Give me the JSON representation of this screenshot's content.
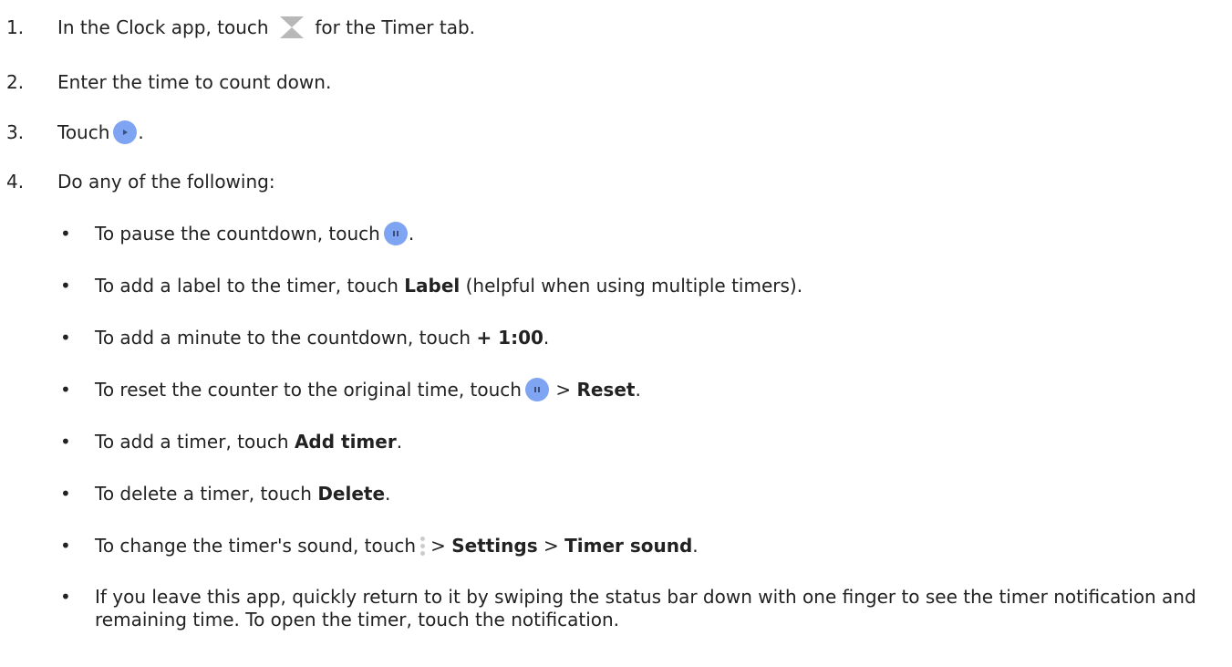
{
  "steps": [
    {
      "num": "1.",
      "pre": "In the Clock app, touch",
      "post": "for the Timer tab."
    },
    {
      "num": "2.",
      "text": "Enter the time to count down."
    },
    {
      "num": "3.",
      "pre": "Touch",
      "post": "."
    },
    {
      "num": "4.",
      "text": "Do any of the following:"
    }
  ],
  "bullet_char": "•",
  "bullets": [
    {
      "pre": "To pause the countdown, touch",
      "post": "."
    },
    {
      "pre": "To add a label to the timer, touch",
      "bold": "Label",
      "post": "(helpful when using multiple timers)."
    },
    {
      "pre": "To add a minute to the countdown, touch",
      "bold": "+ 1:00",
      "post": "."
    },
    {
      "pre": "To reset the counter to the original time, touch",
      "sep": ">",
      "bold": "Reset",
      "post": "."
    },
    {
      "pre": "To add a timer, touch",
      "bold": "Add timer",
      "post": "."
    },
    {
      "pre": "To delete a timer, touch",
      "bold": "Delete",
      "post": "."
    },
    {
      "pre": "To change the timer's sound, touch",
      "sep1": ">",
      "bold1": "Settings",
      "sep2": ">",
      "bold2": "Timer sound",
      "post": "."
    },
    {
      "text": "If you leave this app, quickly return to it by swiping the status bar down with one finger to see the timer notification and remaining time. To open the timer, touch the notification."
    }
  ],
  "icons": {
    "timer_tab": "hourglass-icon",
    "start": "play-icon",
    "pause": "pause-icon",
    "menu": "more-vert-icon"
  },
  "colors": {
    "button_fill": "#7ea4f2",
    "hourglass": "#b8b8b8",
    "menu_dots": "#cccccc"
  }
}
